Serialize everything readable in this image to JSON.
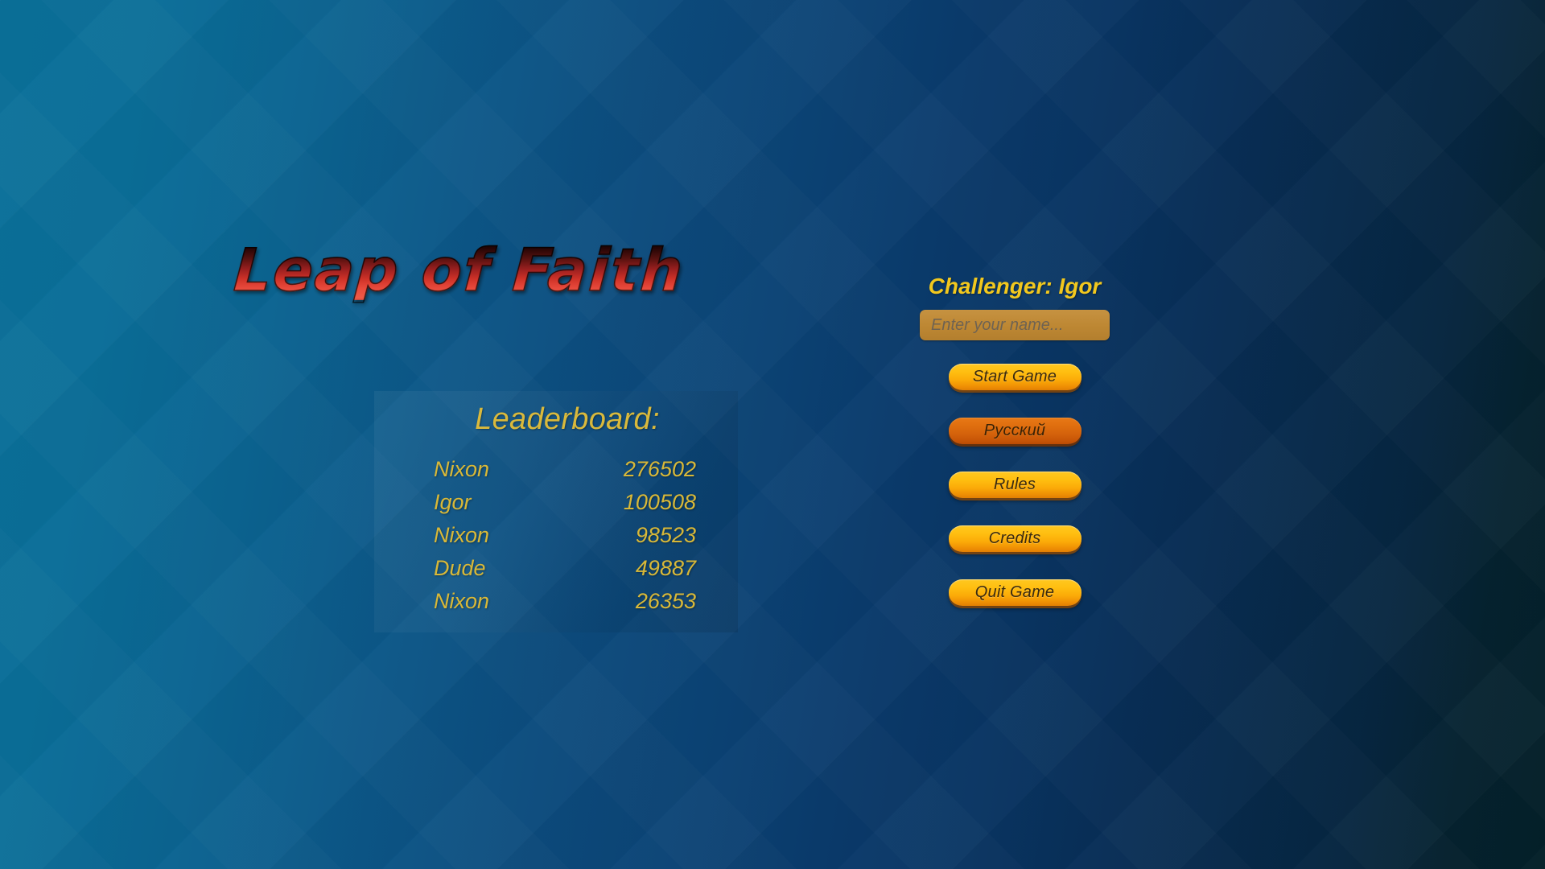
{
  "app": {
    "title": "Leap of Faith"
  },
  "leaderboard": {
    "heading": "Leaderboard:",
    "rows": [
      {
        "name": "Nixon",
        "score": "276502"
      },
      {
        "name": "Igor",
        "score": "100508"
      },
      {
        "name": "Nixon",
        "score": "98523"
      },
      {
        "name": "Dude",
        "score": "49887"
      },
      {
        "name": "Nixon",
        "score": "26353"
      }
    ]
  },
  "menu": {
    "challenger_label": "Challenger: Igor",
    "name_input": {
      "value": "",
      "placeholder": "Enter your name..."
    },
    "buttons": [
      {
        "label": "Start Game",
        "state": "normal"
      },
      {
        "label": "Русский",
        "state": "highlight"
      },
      {
        "label": "Rules",
        "state": "normal"
      },
      {
        "label": "Credits",
        "state": "normal"
      },
      {
        "label": "Quit Game",
        "state": "normal"
      }
    ]
  },
  "colors": {
    "title_gradient_top": "#120202",
    "title_gradient_bottom": "#ef5a46",
    "gold_text": "#d8b838",
    "challenger_gold": "#f2c81e",
    "button_top": "#ffc820",
    "button_bottom": "#e07e03",
    "button_highlight_top": "#e87916",
    "button_highlight_bottom": "#ba4b04",
    "input_background": "#bd8733",
    "background_left": "#0a7099",
    "background_right": "#042029"
  }
}
